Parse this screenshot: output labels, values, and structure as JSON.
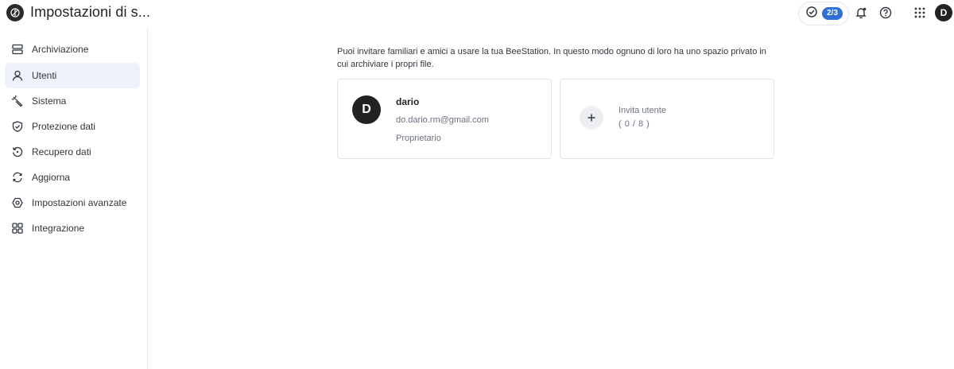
{
  "header": {
    "title": "Impostazioni di s...",
    "tasks_badge": "2/3",
    "user_initial": "D",
    "icons": [
      "logo-icon",
      "task-check-icon",
      "bell-icon",
      "help-icon",
      "apps-grid-icon"
    ]
  },
  "sidebar": {
    "items": [
      {
        "label": "Archiviazione",
        "icon": "storage-icon"
      },
      {
        "label": "Utenti",
        "icon": "user-icon",
        "active": true
      },
      {
        "label": "Sistema",
        "icon": "wrench-icon"
      },
      {
        "label": "Protezione dati",
        "icon": "shield-check-icon"
      },
      {
        "label": "Recupero dati",
        "icon": "restore-icon"
      },
      {
        "label": "Aggiorna",
        "icon": "refresh-icon"
      },
      {
        "label": "Impostazioni avanzate",
        "icon": "advanced-settings-icon"
      },
      {
        "label": "Integrazione",
        "icon": "integration-icon"
      }
    ]
  },
  "main": {
    "intro": "Puoi invitare familiari e amici a usare la tua BeeStation. In questo modo ognuno di loro ha uno spazio privato in cui archiviare i propri file.",
    "user_card": {
      "initial": "D",
      "name": "dario",
      "email": "do.dario.rm@gmail.com",
      "role": "Proprietario"
    },
    "invite_card": {
      "label": "Invita utente",
      "count": "( 0 / 8 )"
    }
  },
  "colors": {
    "accent": "#2f6fd6",
    "active_bg": "#eef3fb",
    "border": "#e1e4e8"
  }
}
